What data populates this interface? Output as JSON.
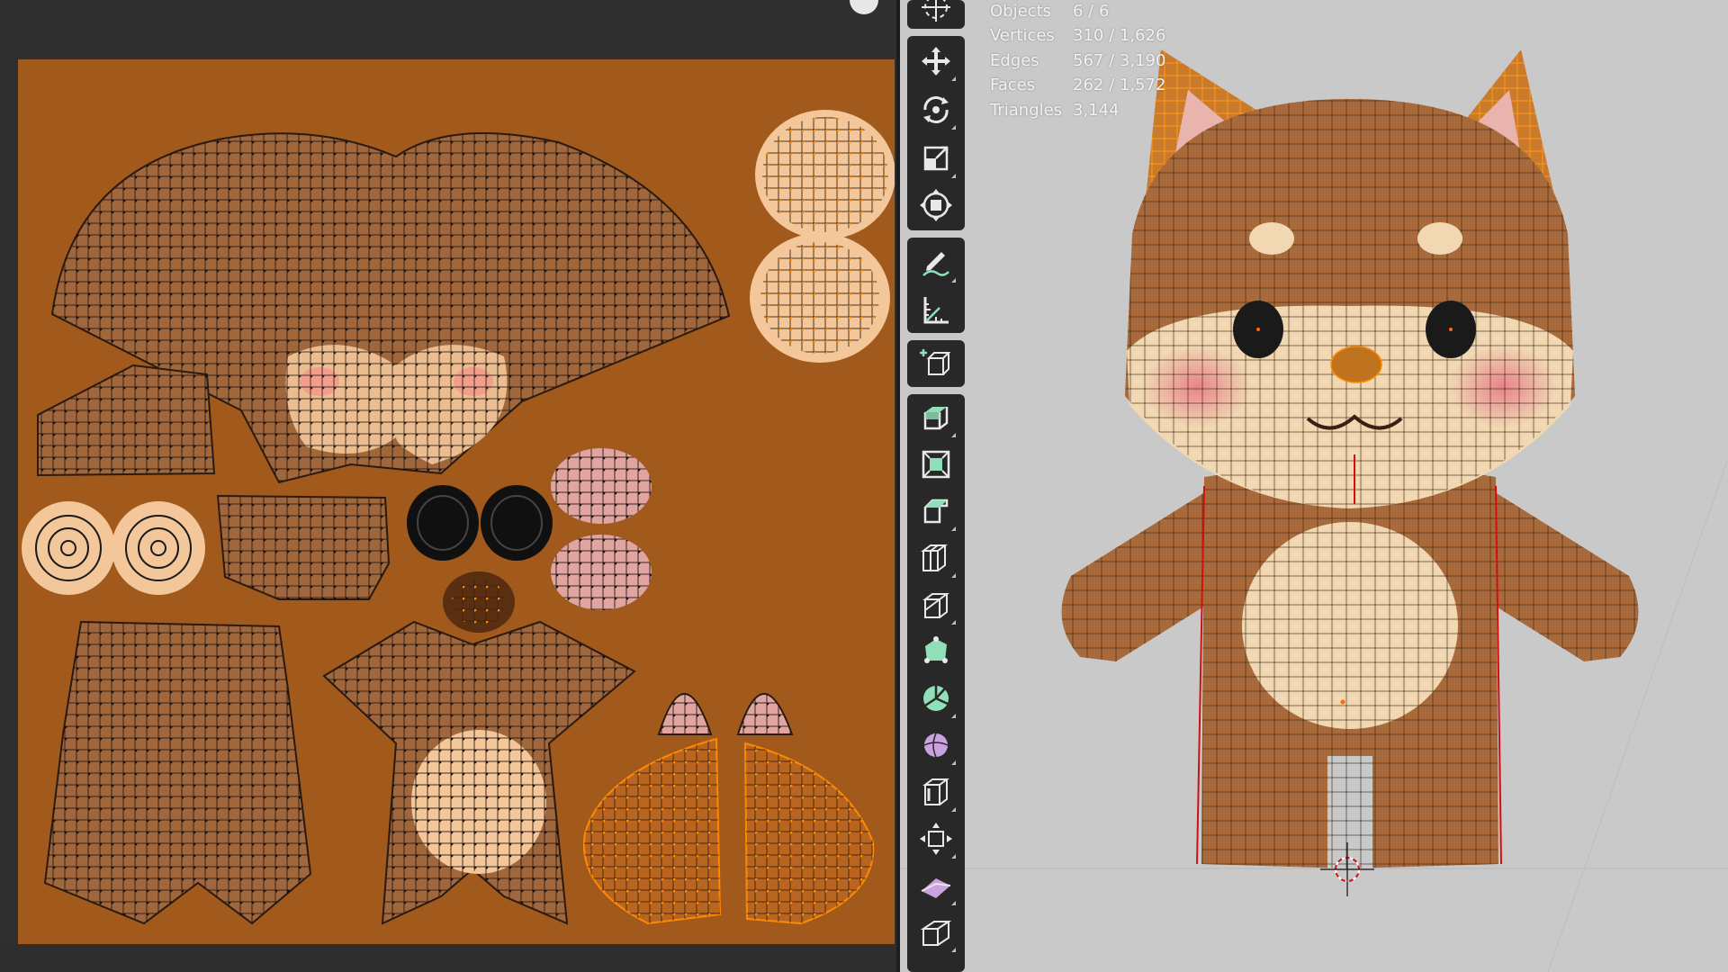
{
  "stats": {
    "rows": [
      {
        "label": "Objects",
        "value": "6 / 6"
      },
      {
        "label": "Vertices",
        "value": "310 / 1,626"
      },
      {
        "label": "Edges",
        "value": "567 / 3,190"
      },
      {
        "label": "Faces",
        "value": "262 / 1,572"
      },
      {
        "label": "Triangles",
        "value": "3,144"
      }
    ]
  },
  "toolbar": {
    "tools": [
      {
        "name": "cursor-tool",
        "icon": "cursor-icon"
      },
      {
        "name": "move-tool",
        "icon": "move-icon"
      },
      {
        "name": "rotate-tool",
        "icon": "rotate-icon"
      },
      {
        "name": "scale-tool",
        "icon": "scale-icon"
      },
      {
        "name": "transform-tool",
        "icon": "transform-icon"
      },
      {
        "name": "annotate-tool",
        "icon": "annotate-icon"
      },
      {
        "name": "measure-tool",
        "icon": "measure-icon"
      },
      {
        "name": "add-cube-tool",
        "icon": "add-cube-icon"
      },
      {
        "name": "extrude-region-tool",
        "icon": "extrude-icon"
      },
      {
        "name": "inset-faces-tool",
        "icon": "inset-icon"
      },
      {
        "name": "bevel-tool",
        "icon": "bevel-icon"
      },
      {
        "name": "loop-cut-tool",
        "icon": "loop-cut-icon"
      },
      {
        "name": "knife-tool",
        "icon": "knife-icon"
      },
      {
        "name": "poly-build-tool",
        "icon": "poly-build-icon"
      },
      {
        "name": "spin-tool",
        "icon": "spin-icon"
      },
      {
        "name": "smooth-tool",
        "icon": "smooth-icon"
      },
      {
        "name": "edge-slide-tool",
        "icon": "edge-slide-icon"
      },
      {
        "name": "shrink-fatten-tool",
        "icon": "shrink-fatten-icon"
      },
      {
        "name": "shear-tool",
        "icon": "shear-icon"
      },
      {
        "name": "rip-region-tool",
        "icon": "rip-icon"
      }
    ]
  },
  "colors": {
    "uv_background": "#a15a1c",
    "island_fill": "#a0673d",
    "vertex_dot": "#111111",
    "selected": "#ff8a00",
    "viewport_background": "#c9c9c9",
    "toolbar_background": "#282828",
    "toolbar_icon_active": "#8fe0b8"
  }
}
